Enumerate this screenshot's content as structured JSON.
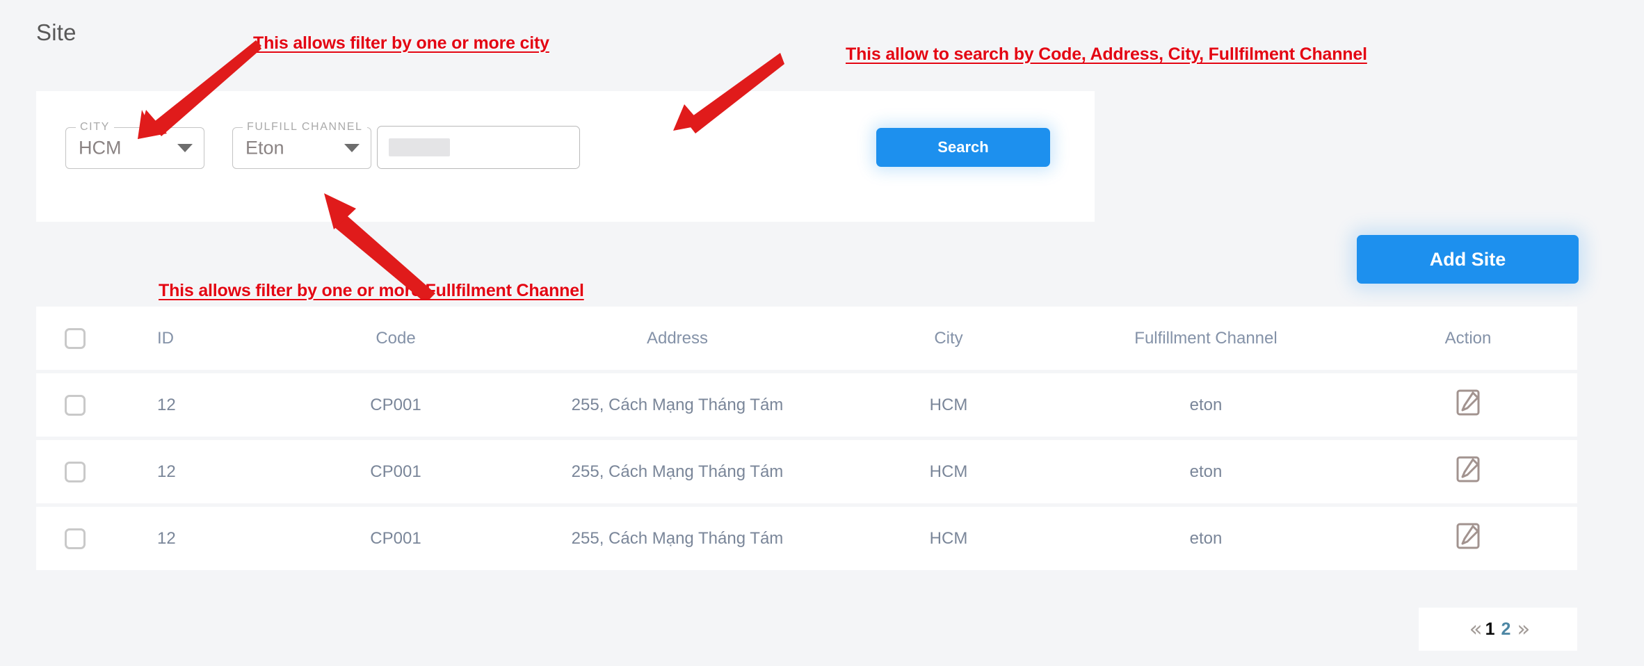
{
  "page": {
    "title": "Site"
  },
  "filters": {
    "city": {
      "label": "CITY",
      "value": "HCM",
      "caret_icon": "chevron-down-icon"
    },
    "fulfill_channel": {
      "label": "FULFILL CHANNEL",
      "value": "Eton",
      "caret_icon": "chevron-down-icon"
    },
    "search": {
      "value": "",
      "placeholder": ""
    },
    "search_button": "Search"
  },
  "actions": {
    "add_site": "Add Site"
  },
  "table": {
    "columns": [
      "ID",
      "Code",
      "Address",
      "City",
      "Fulfillment Channel",
      "Action"
    ],
    "rows": [
      {
        "id": "12",
        "code": "CP001",
        "address": "255, Cách Mạng Tháng Tám",
        "city": "HCM",
        "channel": "eton",
        "action_icon": "edit-pencil-icon"
      },
      {
        "id": "12",
        "code": "CP001",
        "address": "255, Cách Mạng Tháng Tám",
        "city": "HCM",
        "channel": "eton",
        "action_icon": "edit-pencil-icon"
      },
      {
        "id": "12",
        "code": "CP001",
        "address": "255, Cách Mạng Tháng Tám",
        "city": "HCM",
        "channel": "eton",
        "action_icon": "edit-pencil-icon"
      }
    ]
  },
  "pagination": {
    "first": "«",
    "last": "»",
    "pages": [
      "1",
      "2"
    ],
    "active": "1"
  },
  "annotations": {
    "city": "This allows filter by one or more city",
    "search": "This allow to search by Code, Address, City, Fullfilment Channel",
    "fulfill": "This allows filter by one or more Fullfilment Channel"
  },
  "colors": {
    "accent": "#1d90ee",
    "annotation": "#e30613",
    "page_bg": "#f4f5f7",
    "table_text": "#7a8699"
  }
}
